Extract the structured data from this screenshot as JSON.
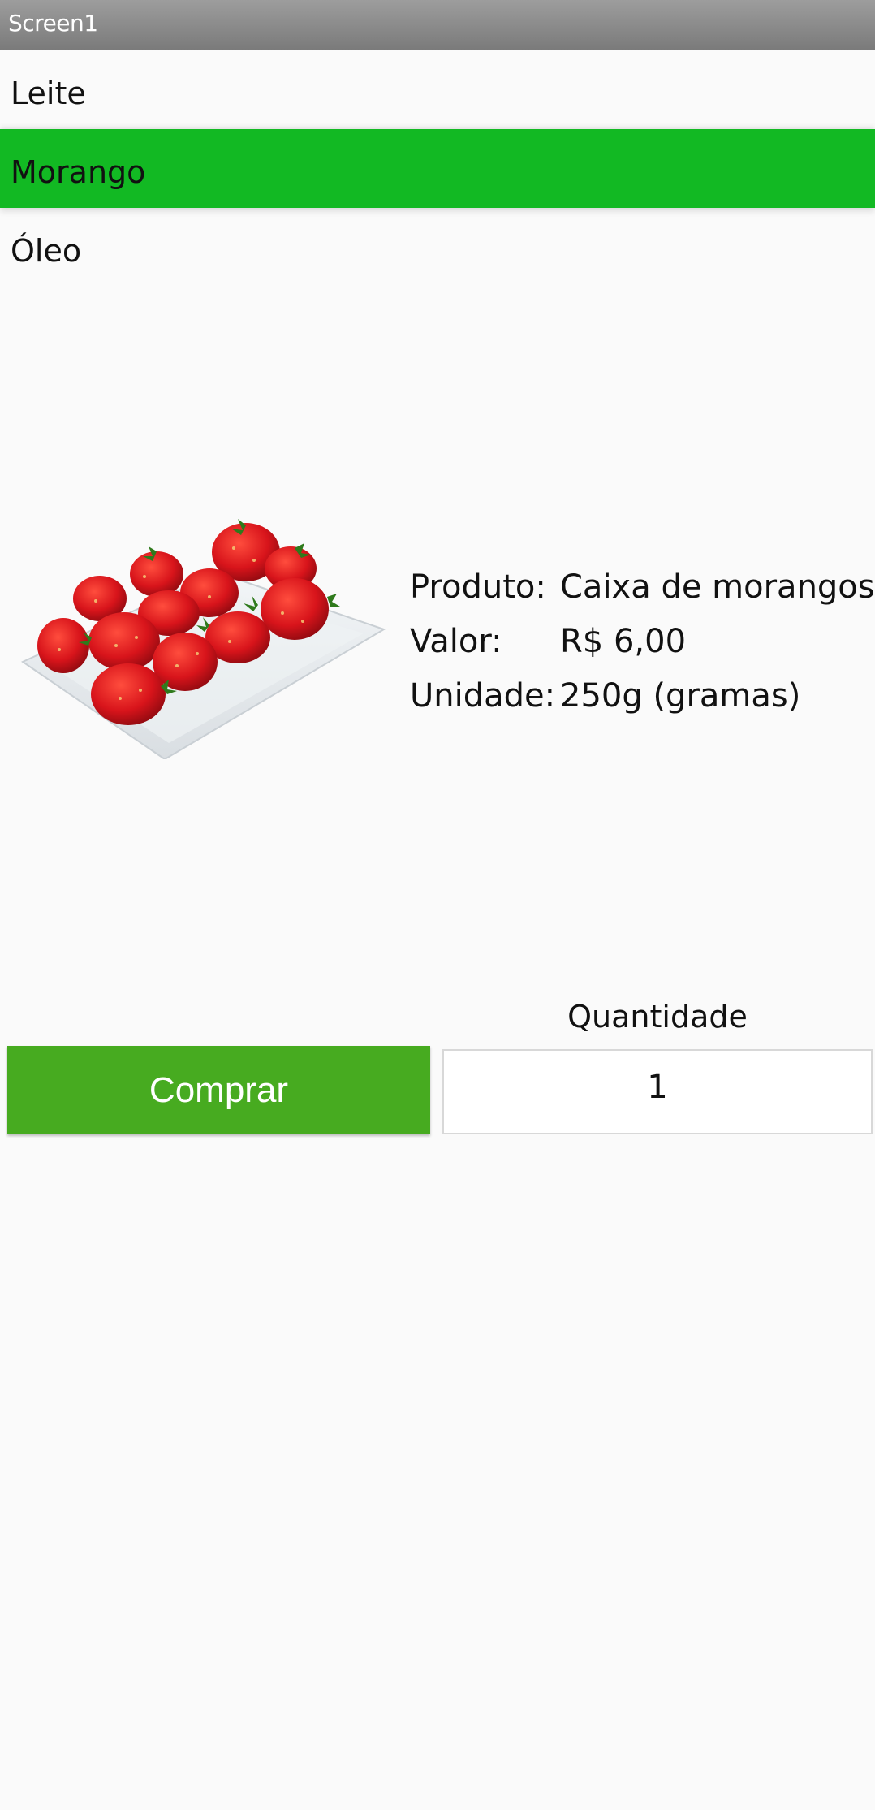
{
  "window": {
    "title": "Screen1"
  },
  "list": {
    "items": [
      {
        "label": "Leite"
      },
      {
        "label": "Morango"
      },
      {
        "label": "Óleo"
      }
    ],
    "selected_color": "#12b923"
  },
  "product": {
    "image_icon": "strawberry-box-image",
    "rows": [
      {
        "label": "Produto:",
        "value": "Caixa de morangos"
      },
      {
        "label": "Valor:",
        "value": "R$ 6,00"
      },
      {
        "label": "Unidade:",
        "value": "250g (gramas)"
      }
    ]
  },
  "purchase": {
    "button_label": "Comprar",
    "button_color": "#47ab20",
    "quantity_label": "Quantidade",
    "quantity_value": "1"
  }
}
